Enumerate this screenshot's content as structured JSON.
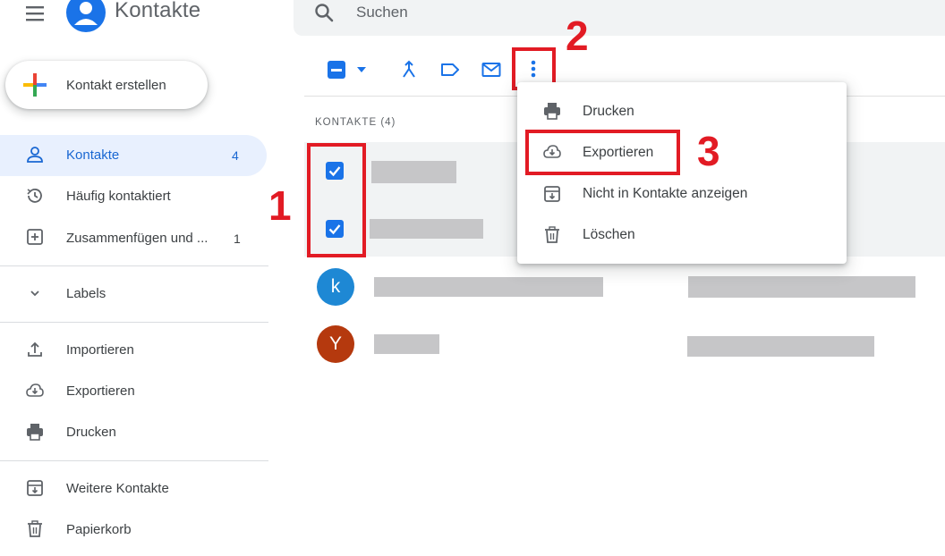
{
  "header": {
    "app_title": "Kontakte",
    "search_placeholder": "Suchen",
    "menu_icon": "hamburger-icon",
    "logo_icon": "person-icon"
  },
  "sidebar": {
    "create_label": "Kontakt erstellen",
    "items": [
      {
        "label": "Kontakte",
        "count": "4",
        "icon": "person-outline-icon",
        "active": true
      },
      {
        "label": "Häufig kontaktiert",
        "count": "",
        "icon": "history-icon",
        "active": false
      },
      {
        "label": "Zusammenfügen und ...",
        "count": "1",
        "icon": "merge-box-icon",
        "active": false
      }
    ],
    "labels_label": "Labels",
    "tools": [
      {
        "label": "Importieren",
        "icon": "upload-icon"
      },
      {
        "label": "Exportieren",
        "icon": "cloud-download-icon"
      },
      {
        "label": "Drucken",
        "icon": "printer-icon"
      }
    ],
    "more": [
      {
        "label": "Weitere Kontakte",
        "icon": "archive-icon"
      },
      {
        "label": "Papierkorb",
        "icon": "trash-icon"
      }
    ]
  },
  "toolbar": {
    "icons": [
      "select-all-checkbox",
      "dropdown-caret-icon",
      "merge-icon",
      "label-icon",
      "mail-icon",
      "more-vert-icon"
    ]
  },
  "contacts": {
    "section_title": "KONTAKTE (4)",
    "avatars": [
      {
        "letter": "k",
        "color": "#1e88d4"
      },
      {
        "letter": "Y",
        "color": "#b5390e"
      }
    ]
  },
  "menu": {
    "items": [
      {
        "label": "Drucken",
        "icon": "printer-icon"
      },
      {
        "label": "Exportieren",
        "icon": "cloud-download-icon"
      },
      {
        "label": "Nicht in Kontakte anzeigen",
        "icon": "archive-icon"
      },
      {
        "label": "Löschen",
        "icon": "trash-icon"
      }
    ]
  },
  "annotations": {
    "step1": "1",
    "step2": "2",
    "step3": "3",
    "highlight_color": "#e21b24"
  },
  "colors": {
    "accent": "#1a73e8",
    "active_bg": "#e8f0fe"
  }
}
